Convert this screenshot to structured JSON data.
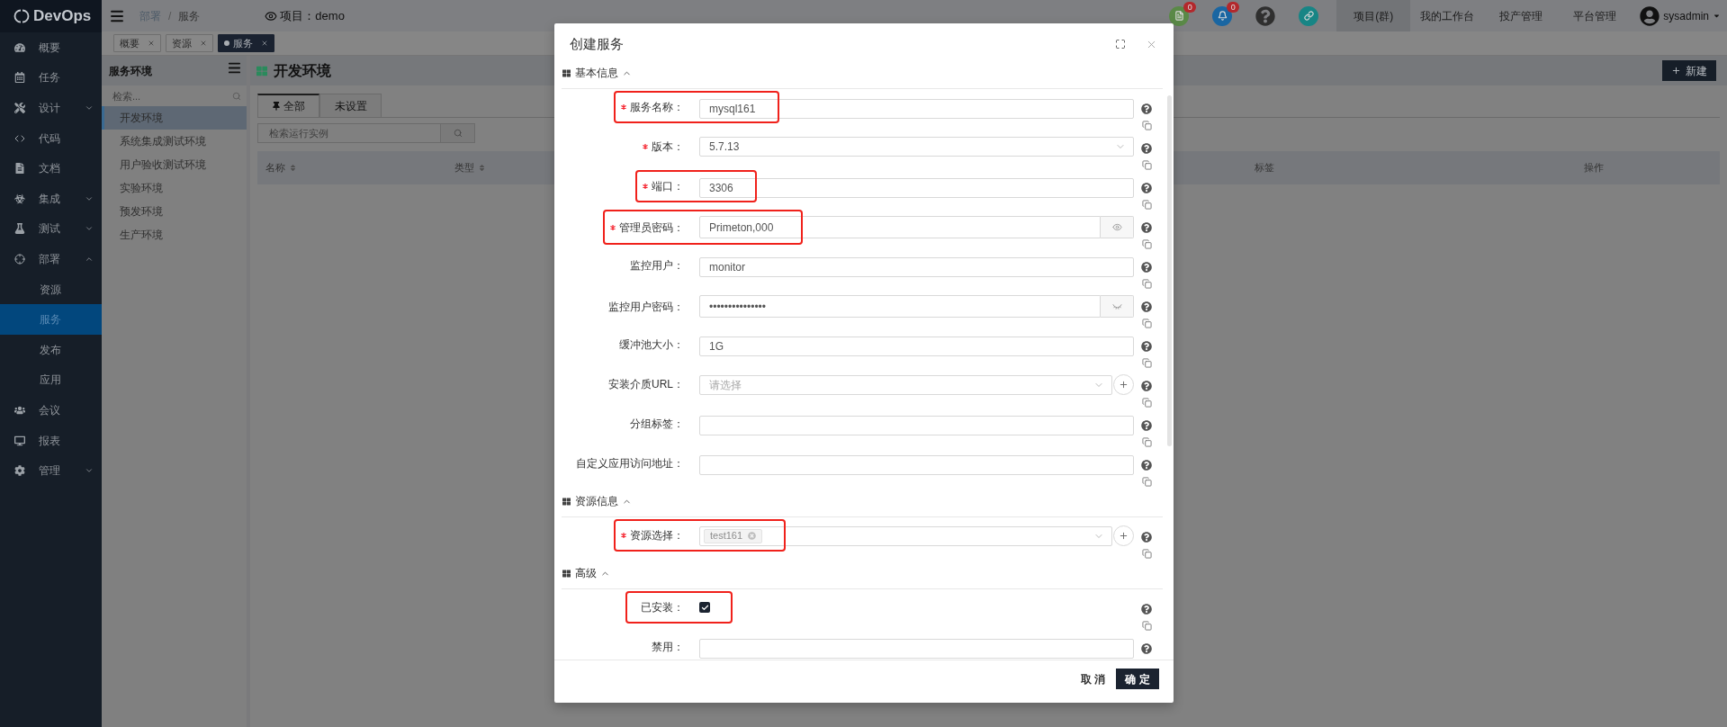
{
  "sidebar": {
    "logo": "DevOps",
    "items": [
      {
        "label": "概要",
        "selected": false
      },
      {
        "label": "任务",
        "selected": false
      },
      {
        "label": "设计",
        "selected": false,
        "expanded": false
      },
      {
        "label": "代码",
        "selected": false
      },
      {
        "label": "文档",
        "selected": false
      },
      {
        "label": "集成",
        "selected": false,
        "expanded": false
      },
      {
        "label": "测试",
        "selected": false,
        "expanded": false
      },
      {
        "label": "部署",
        "selected": false,
        "expanded": true,
        "children": [
          {
            "label": "资源",
            "selected": false
          },
          {
            "label": "服务",
            "selected": true
          },
          {
            "label": "发布",
            "selected": false
          },
          {
            "label": "应用",
            "selected": false
          }
        ]
      },
      {
        "label": "会议",
        "selected": false
      },
      {
        "label": "报表",
        "selected": false
      },
      {
        "label": "管理",
        "selected": false,
        "expanded": false
      }
    ]
  },
  "header": {
    "breadcrumb": {
      "items": [
        "部署",
        "服务"
      ],
      "separator": "/"
    },
    "project": {
      "label": "项目：",
      "value": "demo"
    },
    "icons": [
      {
        "kind": "document",
        "badge": "0"
      },
      {
        "kind": "bell",
        "badge": "0"
      },
      {
        "kind": "help"
      },
      {
        "kind": "link"
      }
    ],
    "nav": [
      {
        "label": "项目(群)",
        "selected": true
      },
      {
        "label": "我的工作台",
        "selected": false
      },
      {
        "label": "投产管理",
        "selected": false
      },
      {
        "label": "平台管理",
        "selected": false
      }
    ],
    "user": "sysadmin"
  },
  "open_tabs": [
    {
      "label": "概要",
      "selected": false
    },
    {
      "label": "资源",
      "selected": false
    },
    {
      "label": "服务",
      "selected": true
    }
  ],
  "environment_panel": {
    "title": "服务环境",
    "search": {
      "placeholder": "检索..."
    },
    "items": [
      {
        "label": "开发环境",
        "selected": true
      },
      {
        "label": "系统集成测试环境",
        "selected": false
      },
      {
        "label": "用户验收测试环境",
        "selected": false
      },
      {
        "label": "实验环境",
        "selected": false
      },
      {
        "label": "预发环境",
        "selected": false
      },
      {
        "label": "生产环境",
        "selected": false
      }
    ]
  },
  "content": {
    "title": "开发环境",
    "new_button": {
      "label": "新建"
    },
    "tabs": [
      {
        "label": "全部",
        "selected": true,
        "pinned": true
      },
      {
        "label": "未设置",
        "selected": false,
        "pinned": false
      }
    ],
    "search": {
      "placeholder": "检索运行实例"
    },
    "table": {
      "columns": [
        {
          "label": "名称",
          "sortable": true
        },
        {
          "label": "类型",
          "sortable": true
        },
        {
          "label": "标签",
          "sortable": false
        },
        {
          "label": "操作",
          "sortable": false
        }
      ]
    }
  },
  "dialog": {
    "title": "创建服务",
    "sections": [
      {
        "title": "基本信息",
        "expanded": true,
        "fields": [
          {
            "label": "服务名称：",
            "required": true,
            "kind": "text",
            "value": "mysql161",
            "highlighted": true
          },
          {
            "label": "版本：",
            "required": true,
            "kind": "select",
            "value": "5.7.13",
            "addable": false,
            "highlighted": false
          },
          {
            "label": "端口：",
            "required": true,
            "kind": "text",
            "value": "3306",
            "highlighted": true
          },
          {
            "label": "管理员密码：",
            "required": true,
            "kind": "password",
            "value": "Primeton,000",
            "revealed": true,
            "highlighted": true
          },
          {
            "label": "监控用户：",
            "required": false,
            "kind": "text",
            "value": "monitor",
            "highlighted": false
          },
          {
            "label": "监控用户密码：",
            "required": false,
            "kind": "password",
            "value": "•••••••••••••••",
            "revealed": false,
            "highlighted": false
          },
          {
            "label": "缓冲池大小：",
            "required": false,
            "kind": "text",
            "value": "1G",
            "highlighted": false
          },
          {
            "label": "安装介质URL：",
            "required": false,
            "kind": "select",
            "placeholder": "请选择",
            "addable": true,
            "highlighted": false
          },
          {
            "label": "分组标签：",
            "required": false,
            "kind": "text",
            "highlighted": false
          },
          {
            "label": "自定义应用访问地址：",
            "required": false,
            "kind": "text",
            "highlighted": false
          }
        ]
      },
      {
        "title": "资源信息",
        "expanded": true,
        "fields": [
          {
            "label": "资源选择：",
            "required": true,
            "kind": "tags",
            "tags": [
              "test161"
            ],
            "addable": true,
            "highlighted": true
          }
        ]
      },
      {
        "title": "高级",
        "expanded": true,
        "fields": [
          {
            "label": "已安装：",
            "required": false,
            "kind": "checkbox",
            "checked": true,
            "highlighted": true
          },
          {
            "label": "禁用：",
            "required": false,
            "kind": "text",
            "highlighted": false
          }
        ]
      }
    ],
    "buttons": [
      {
        "label": "取 消",
        "kind": "secondary"
      },
      {
        "label": "确 定",
        "kind": "primary"
      }
    ]
  }
}
